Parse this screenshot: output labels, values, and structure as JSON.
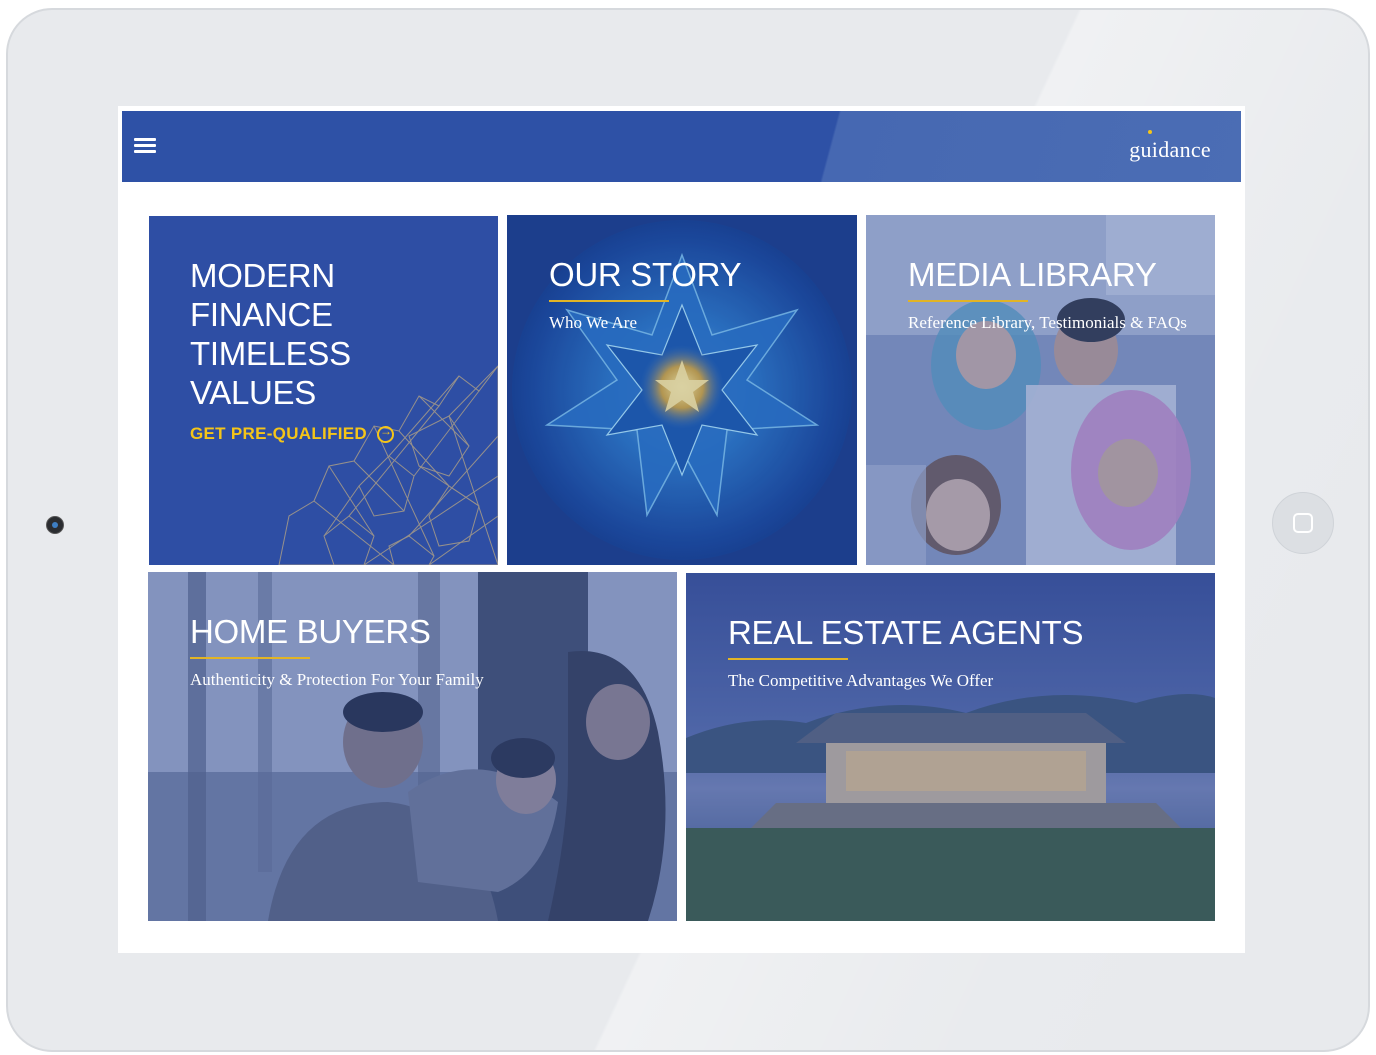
{
  "app": {
    "logo_text": "guidance",
    "brand_color": "#2e51a6",
    "accent_color": "#f5c518",
    "menu_icon": "hamburger-menu-icon"
  },
  "tiles": {
    "finance": {
      "title_line1": "MODERN FINANCE",
      "title_line2": "TIMELESS VALUES",
      "cta_label": "GET PRE-QUALIFIED",
      "cta_icon": "arrow-circle-right-icon"
    },
    "story": {
      "title": "OUR STORY",
      "subtitle": "Who We Are"
    },
    "media": {
      "title": "MEDIA LIBRARY",
      "subtitle": "Reference Library, Testimonials & FAQs"
    },
    "home": {
      "title": "HOME BUYERS",
      "subtitle": "Authenticity & Protection For Your Family"
    },
    "agents": {
      "title": "REAL ESTATE AGENTS",
      "subtitle": "The Competitive Advantages We Offer"
    }
  }
}
